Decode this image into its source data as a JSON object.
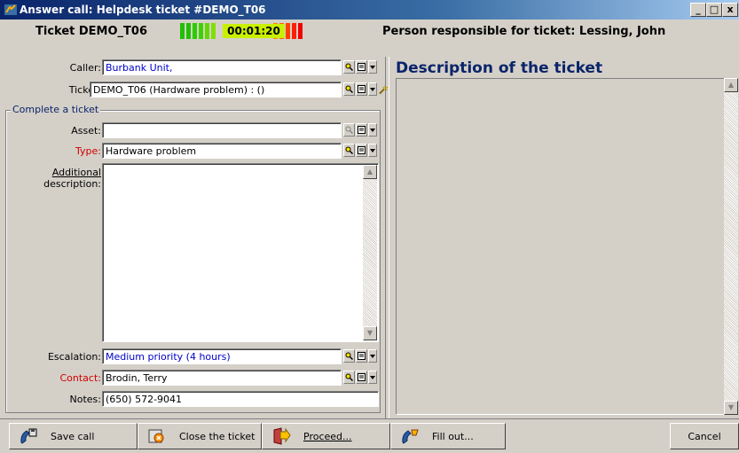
{
  "window": {
    "title": "Answer call: Helpdesk ticket #DEMO_T06",
    "minimize": "_",
    "restore": "□",
    "close": "x"
  },
  "status": {
    "ticket": "Ticket DEMO_T06",
    "timer": "00:01:20",
    "responsible": "Person responsible for ticket: Lessing, John"
  },
  "form": {
    "caller_label": "Caller:",
    "caller_value": "Burbank Unit,",
    "ticket_label": "Ticket:",
    "ticket_value": "DEMO_T06 (Hardware problem) :  ()",
    "group_label": "Complete a ticket",
    "asset_label": "Asset:",
    "asset_value": "",
    "type_label": "Type:",
    "type_value": "Hardware problem",
    "addl_label_1": "Additional",
    "addl_label_2": "description:",
    "addl_value": "",
    "escalation_label": "Escalation:",
    "escalation_value": "Medium priority (4 hours)",
    "contact_label": "Contact:",
    "contact_value": "Brodin, Terry",
    "notes_label": "Notes:",
    "notes_value": "(650) 572-9041"
  },
  "description": {
    "title": "Description of the ticket"
  },
  "buttons": {
    "save_call": "Save call",
    "close_ticket": "Close the ticket",
    "proceed": "Proceed...",
    "fill_out": "Fill out...",
    "cancel": "Cancel"
  },
  "icons": {
    "search": "search-icon",
    "form": "form-icon",
    "dropdown": "dropdown-arrow-icon",
    "wizard": "wizard-icon"
  }
}
